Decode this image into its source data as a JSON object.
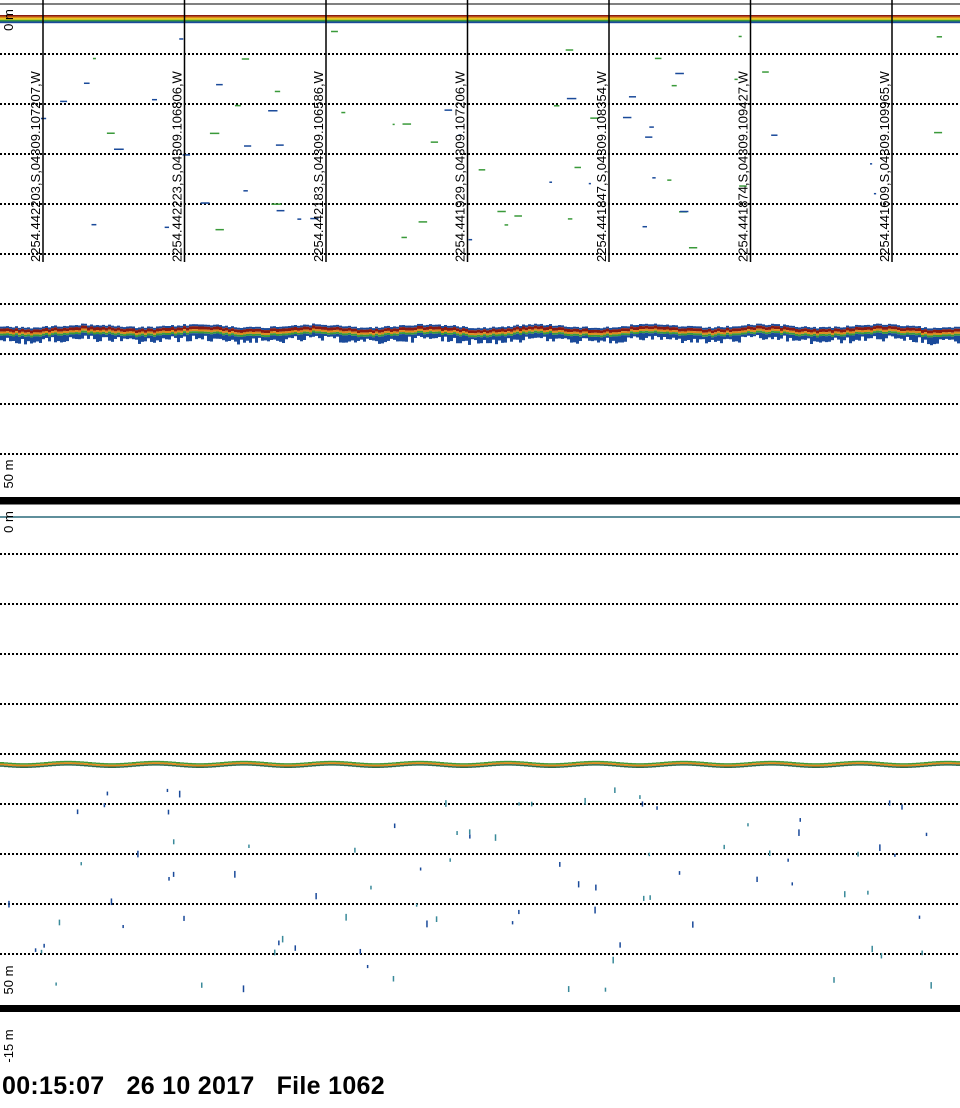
{
  "chart_data": [
    {
      "type": "echogram",
      "panel": "upper",
      "depth_range_m": [
        0,
        50
      ],
      "depth_labels": [
        "0 m",
        "50 m"
      ],
      "range_rings": "every 5 m, dotted",
      "surface_band_depth_m": 1.4,
      "bottom_depth_m": 32.5,
      "ping_markers": [
        "2254.442203,S,04309.107207,W",
        "2254.442223,S,04309.106806,W",
        "2254.442183,S,04309.106586,W",
        "2254.441929,S,04309.107206,W",
        "2254.441847,S,04309.108354,W",
        "2254.441874,S,04309.109427,W",
        "2254.441609,S,04309.109965,W"
      ]
    },
    {
      "type": "echogram",
      "panel": "lower",
      "depth_range_m": [
        0,
        50
      ],
      "depth_labels": [
        "0 m",
        "50 m",
        "-15 m"
      ],
      "range_rings": "every 5 m, dotted",
      "surface_line_depth_m": 1.3,
      "bottom_depth_m": 26.0
    }
  ],
  "footer": {
    "time": "00:15:07",
    "date": "26 10 2017",
    "file": "File 1062"
  },
  "colors": {
    "background": "#ffffff",
    "grid": "#000000",
    "band": [
      "#8b1a10",
      "#e08a1a",
      "#e8d020",
      "#3a9a3a",
      "#1a4a9a"
    ]
  }
}
